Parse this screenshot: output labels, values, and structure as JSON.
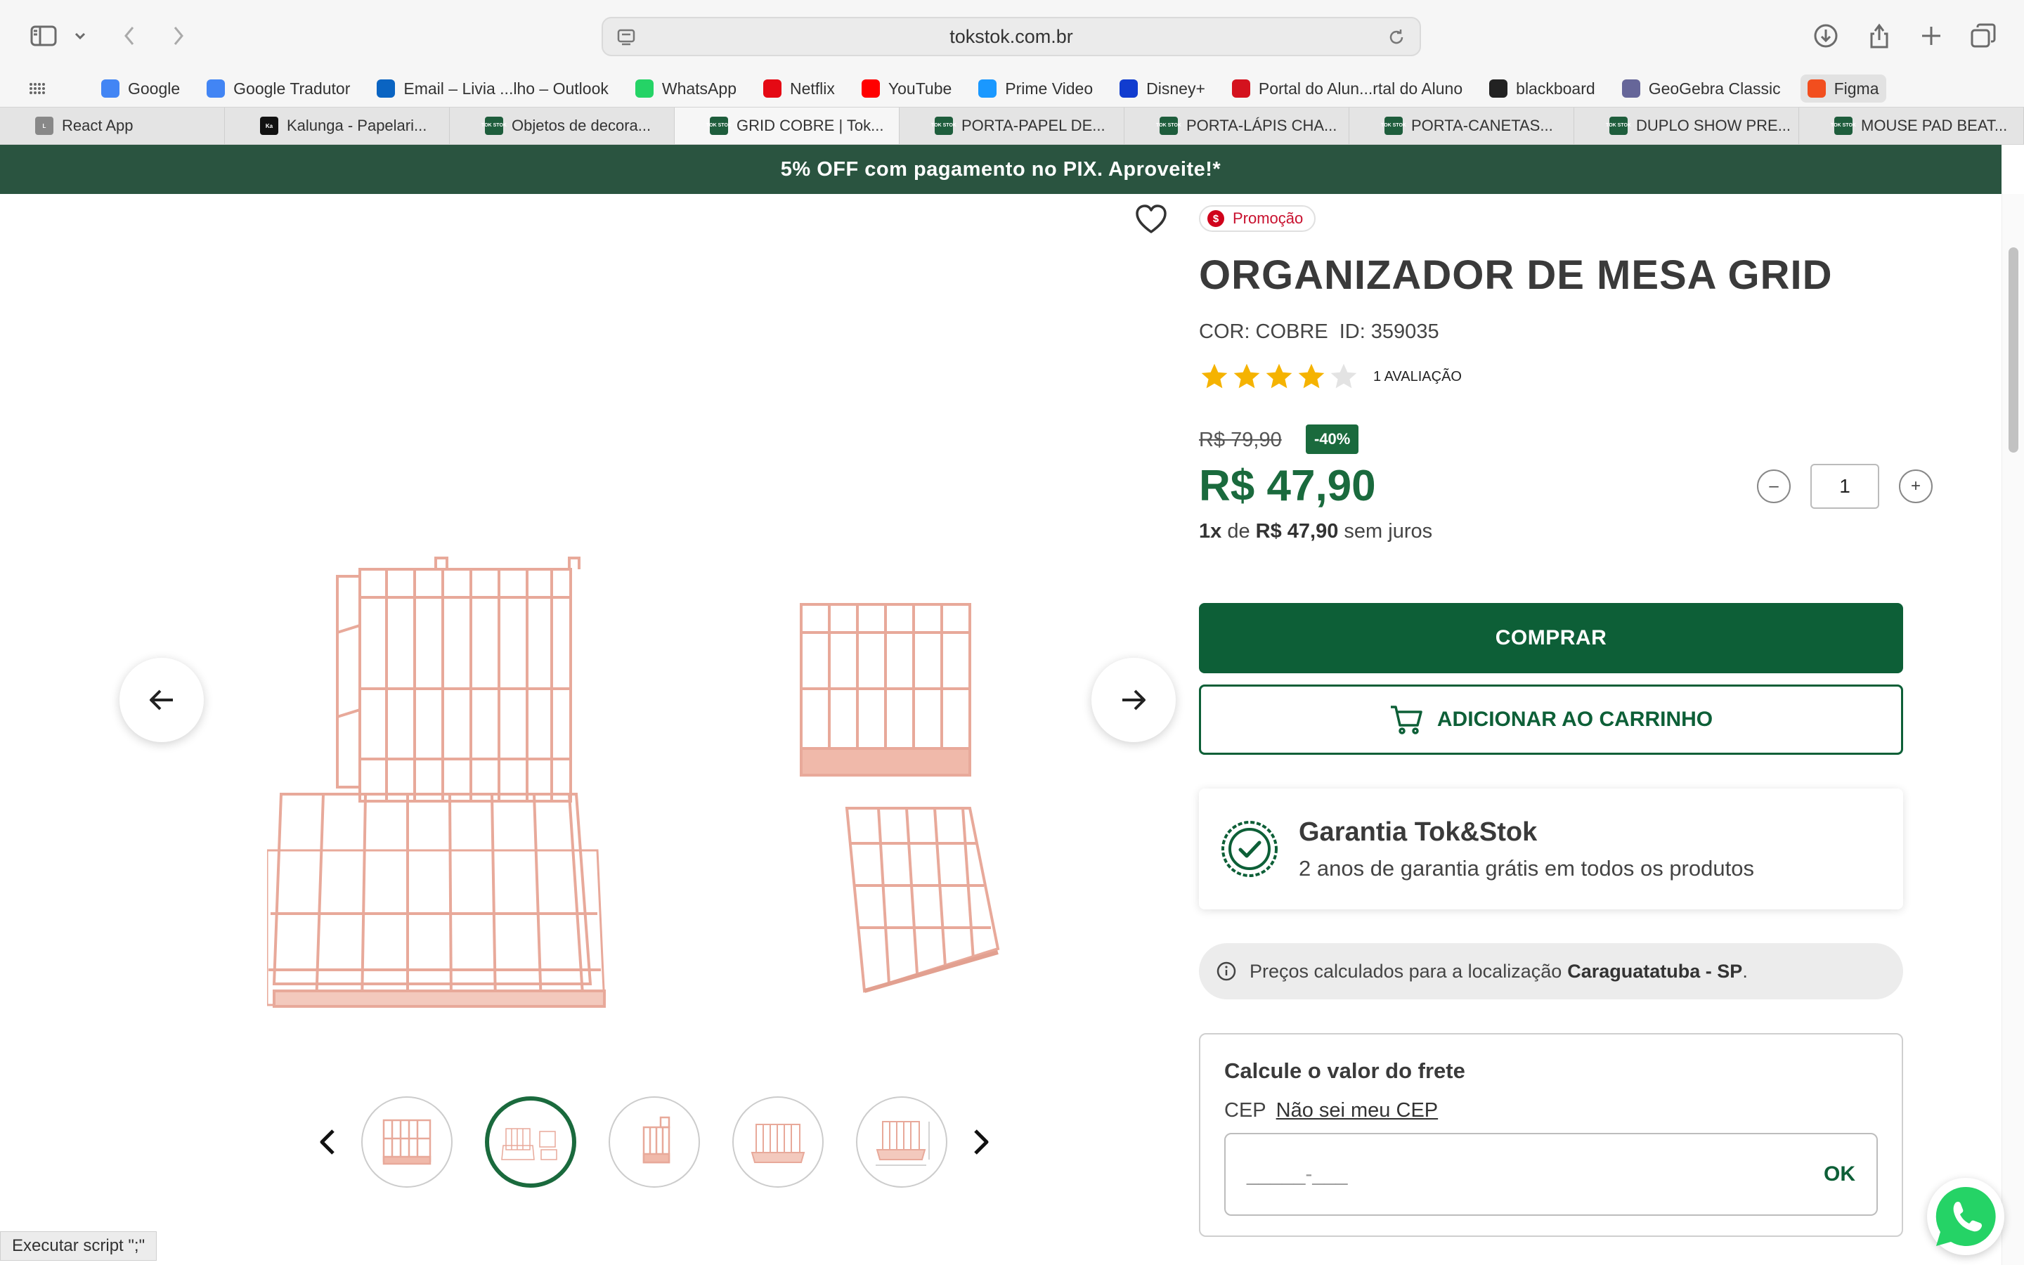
{
  "browser": {
    "url": "tokstok.com.br",
    "bookmarks": [
      {
        "label": "Google",
        "icon": "google-icon",
        "color": "#4285f4"
      },
      {
        "label": "Google Tradutor",
        "icon": "translate-icon",
        "color": "#4285f4"
      },
      {
        "label": "Email – Livia ...lho – Outlook",
        "icon": "outlook-icon",
        "color": "#0a64c2"
      },
      {
        "label": "WhatsApp",
        "icon": "whatsapp-icon",
        "color": "#25d366"
      },
      {
        "label": "Netflix",
        "icon": "netflix-icon",
        "color": "#e50914"
      },
      {
        "label": "YouTube",
        "icon": "youtube-icon",
        "color": "#ff0000"
      },
      {
        "label": "Prime Video",
        "icon": "prime-video-icon",
        "color": "#1a98ff"
      },
      {
        "label": "Disney+",
        "icon": "disney-icon",
        "color": "#113ccf"
      },
      {
        "label": "Portal do Alun...rtal do Aluno",
        "icon": "portal-icon",
        "color": "#d4121e"
      },
      {
        "label": "blackboard",
        "icon": "blackboard-icon",
        "color": "#222222"
      },
      {
        "label": "GeoGebra Classic",
        "icon": "geogebra-icon",
        "color": "#666699"
      },
      {
        "label": "Figma",
        "icon": "figma-icon",
        "color": "#f24e1e"
      }
    ],
    "tabs": [
      {
        "label": "React App",
        "fav": "L",
        "fav_color": "#888888"
      },
      {
        "label": "Kalunga - Papelari...",
        "fav": "Ka",
        "fav_color": "#111111"
      },
      {
        "label": "Objetos de decora...",
        "fav": "TOK STOK",
        "fav_color": "#1e5d3c"
      },
      {
        "label": "GRID COBRE | Tok...",
        "fav": "TOK STOK",
        "fav_color": "#1e5d3c",
        "active": true
      },
      {
        "label": "PORTA-PAPEL DE...",
        "fav": "TOK STOK",
        "fav_color": "#1e5d3c"
      },
      {
        "label": "PORTA-LÁPIS CHA...",
        "fav": "TOK STOK",
        "fav_color": "#1e5d3c"
      },
      {
        "label": "PORTA-CANETAS...",
        "fav": "TOK STOK",
        "fav_color": "#1e5d3c"
      },
      {
        "label": "DUPLO SHOW PRE...",
        "fav": "TOK STOK",
        "fav_color": "#1e5d3c"
      },
      {
        "label": "MOUSE PAD BEAT...",
        "fav": "TOK STOK",
        "fav_color": "#1e5d3c"
      }
    ],
    "status_text": "Executar script \";\""
  },
  "page": {
    "promo_banner": "5% OFF com pagamento no PIX. Aproveite!*",
    "badge": "Promoção",
    "badge_symbol": "$",
    "title": "ORGANIZADOR DE MESA GRID",
    "color_attr": "COR: COBRE",
    "id_attr": "ID: 359035",
    "rating": 4,
    "rating_max": 5,
    "rating_text": "1 AVALIAÇÃO",
    "old_price": "R$ 79,90",
    "discount": "-40%",
    "price": "R$ 47,90",
    "installments_count": "1x",
    "installments_de": "de",
    "installments_value": "R$ 47,90",
    "installments_suffix": "sem juros",
    "quantity": "1",
    "qty_minus": "–",
    "qty_plus": "+",
    "buy_label": "COMPRAR",
    "cart_label": "ADICIONAR AO CARRINHO",
    "warranty_title": "Garantia Tok&Stok",
    "warranty_sub": "2 anos de garantia grátis em todos os produtos",
    "location_prefix": "Preços calculados para a localização",
    "location_city": "Caraguatatuba - SP",
    "location_suffix": ".",
    "freight_title": "Calcule o valor do frete",
    "cep_label": "CEP",
    "cep_link": "Não sei meu CEP",
    "cep_placeholder": "_____-___",
    "ok_label": "OK",
    "gallery_active_thumb": 2,
    "gallery_thumb_count": 5
  },
  "colors": {
    "brand_green": "#0d5f37",
    "promo_bar": "#2a5440",
    "product_copper": "#e8a99a",
    "star": "#f5b301"
  }
}
